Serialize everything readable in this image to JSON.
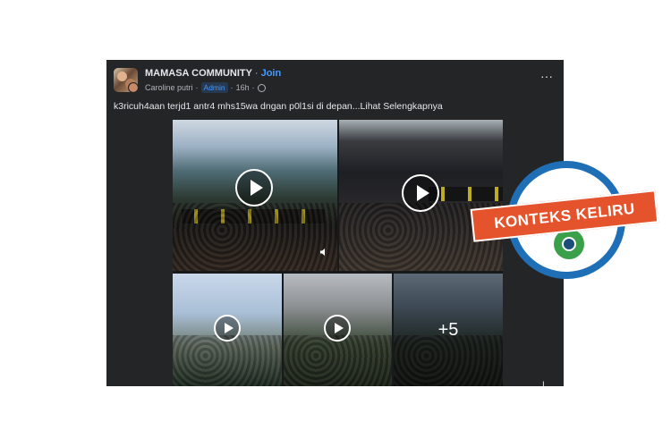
{
  "post": {
    "group_name": "MAMASA COMMUNITY",
    "separator": "·",
    "join_label": "Join",
    "author": "Caroline putri",
    "role_badge": "Admin",
    "time": "16h",
    "more_label": "···",
    "caption": "k3ricuh4aan terjd1 antr4 mhs15wa dngan p0l1si di depan...",
    "see_more": "Lihat Selengkapnya",
    "remaining_count": "+5"
  },
  "icons": {
    "play": "play-icon",
    "globe": "globe-icon",
    "sound": "sound-icon",
    "more": "more-icon"
  },
  "stamp": {
    "label": "KONTEKS KELIRU",
    "banner_color": "#e4532b",
    "ring_color": "#1f6fb6"
  },
  "colors": {
    "post_bg": "#242526",
    "link": "#4599ff",
    "text": "#e4e6eb",
    "muted": "#b0b3b8"
  }
}
